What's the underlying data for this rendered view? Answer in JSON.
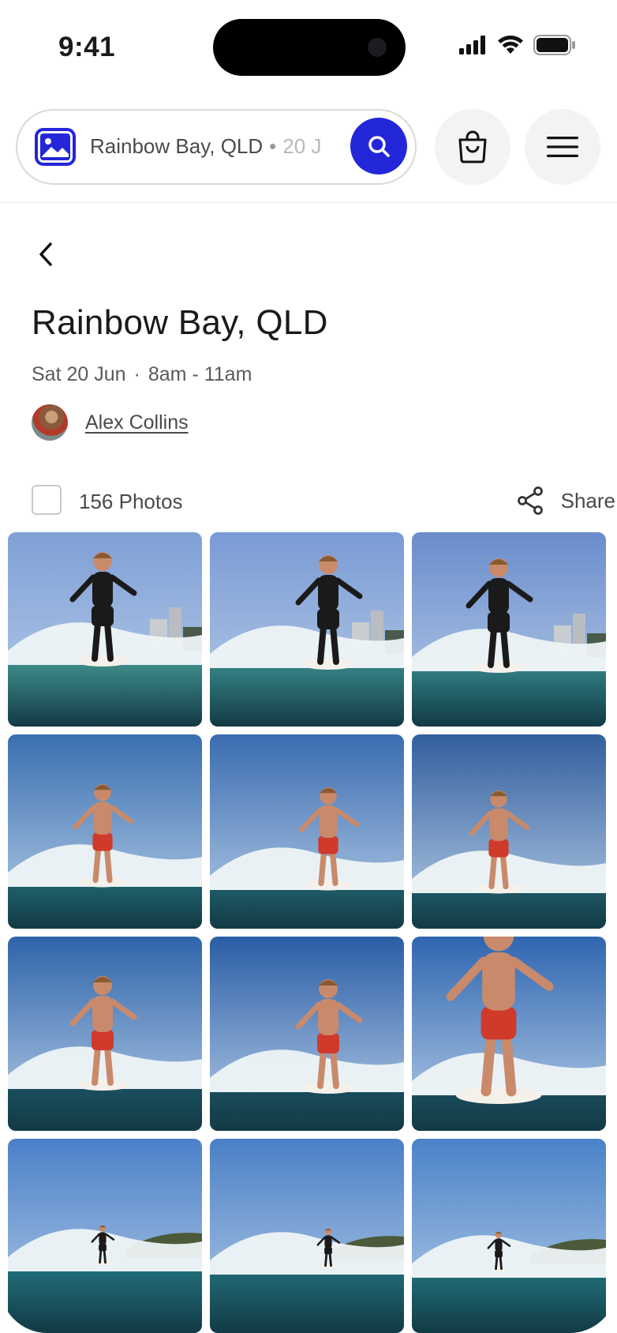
{
  "status_bar": {
    "time": "9:41"
  },
  "search": {
    "location": "Rainbow Bay, QLD",
    "separator": "•",
    "date_partial": "20 J",
    "brand_color": "#2426d9"
  },
  "header": {
    "title": "Rainbow Bay, QLD",
    "date": "Sat 20 Jun",
    "separator": "·",
    "time_range": "8am - 11am",
    "author": "Alex Collins"
  },
  "toolbar": {
    "photo_count": "156 Photos",
    "share_label": "Share"
  },
  "icons": {
    "search_photo": "image-icon",
    "search": "search-icon",
    "cart": "shopping-bag-icon",
    "menu": "hamburger-menu-icon",
    "back": "chevron-left-icon",
    "share": "share-icon"
  },
  "photos": [
    {
      "subject": "surfer in black wetsuit",
      "sky": "#7f9fd6",
      "water": "#3d8a88",
      "body": "#1a1a1a",
      "shorts": "#1a1a1a",
      "buildings": true
    },
    {
      "subject": "surfer in black wetsuit",
      "sky": "#7a9ad4",
      "water": "#347f82",
      "body": "#1a1a1a",
      "shorts": "#1a1a1a",
      "buildings": true
    },
    {
      "subject": "surfer in black wetsuit",
      "sky": "#6a8ccc",
      "water": "#2f7a80",
      "body": "#1a1a1a",
      "shorts": "#1a1a1a",
      "buildings": true
    },
    {
      "subject": "surfer in red shorts",
      "sky": "#3a6fb0",
      "water": "#1f5f6a",
      "body": "#c88a6a",
      "shorts": "#d03a2a",
      "buildings": false
    },
    {
      "subject": "surfer in red shorts",
      "sky": "#3a6cb0",
      "water": "#1e5a66",
      "body": "#c88a6a",
      "shorts": "#d03a2a",
      "buildings": false
    },
    {
      "subject": "surfer in red shorts",
      "sky": "#335f9e",
      "water": "#1d5563",
      "body": "#c88a6a",
      "shorts": "#d03a2a",
      "buildings": false
    },
    {
      "subject": "surfer in red shorts",
      "sky": "#2f64aa",
      "water": "#1a4f5e",
      "body": "#c98a6c",
      "shorts": "#d03a2a",
      "buildings": false
    },
    {
      "subject": "surfer in red shorts",
      "sky": "#2a5da6",
      "water": "#1a4c5c",
      "body": "#c98a6c",
      "shorts": "#d03a2a",
      "buildings": false
    },
    {
      "subject": "surfer in red shorts close-up",
      "sky": "#2f66b0",
      "water": "#1a4a5a",
      "body": "#c98a6c",
      "shorts": "#d03a2a",
      "buildings": false
    },
    {
      "subject": "distant surfer",
      "sky": "#4b80c8",
      "water": "#216c78",
      "body": "#1a1a1a",
      "shorts": "#1a1a1a",
      "buildings": false
    },
    {
      "subject": "distant surfer",
      "sky": "#4a7fc6",
      "water": "#1f6874",
      "body": "#1a1a1a",
      "shorts": "#1a1a1a",
      "buildings": false
    },
    {
      "subject": "distant surfer",
      "sky": "#4a82c8",
      "water": "#1f6a76",
      "body": "#1a1a1a",
      "shorts": "#1a1a1a",
      "buildings": false
    }
  ]
}
